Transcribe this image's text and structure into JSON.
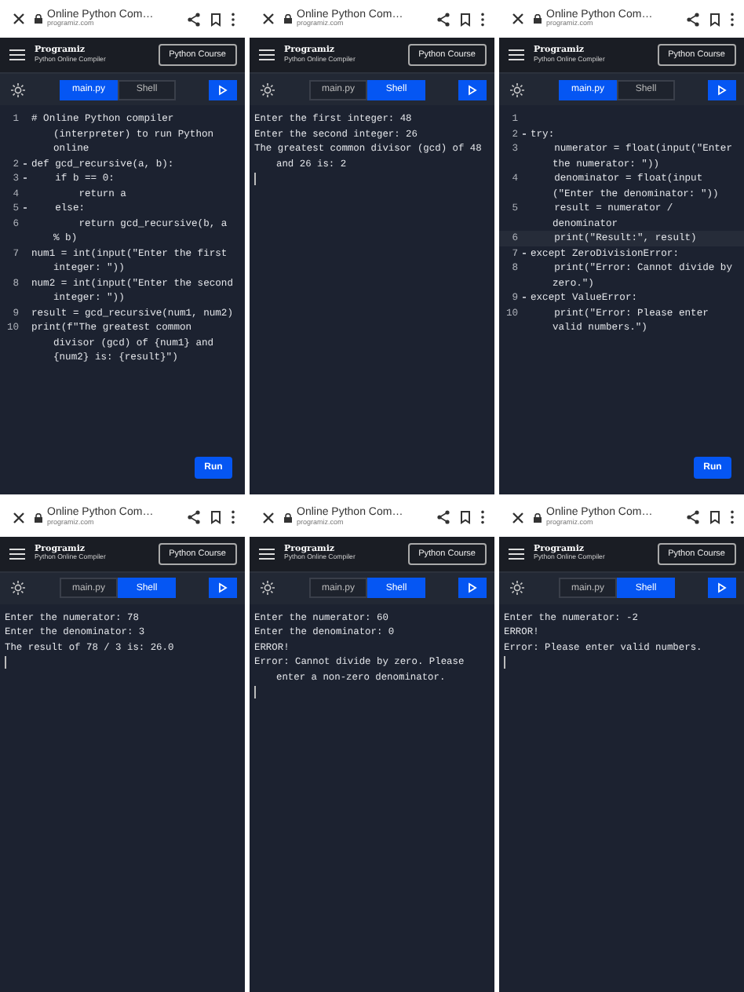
{
  "panels": [
    {
      "browser": {
        "title": "Online Python Com…",
        "url": "programiz.com"
      },
      "header": {
        "logo": "Programiz",
        "subtitle": "Python Online Compiler",
        "course_button": "Python Course"
      },
      "tabs": [
        {
          "label": "main.py",
          "selected": true
        },
        {
          "label": "Shell",
          "selected": false
        }
      ],
      "kind": "editor",
      "lines": [
        {
          "number": "1",
          "fold": false,
          "active": false,
          "text": "# Online Python compiler (interpreter) to run Python online"
        },
        {
          "number": "2",
          "fold": true,
          "active": false,
          "text": "def gcd_recursive(a, b):"
        },
        {
          "number": "3",
          "fold": true,
          "active": false,
          "text": "    if b == 0:"
        },
        {
          "number": "4",
          "fold": false,
          "active": false,
          "text": "        return a"
        },
        {
          "number": "5",
          "fold": true,
          "active": false,
          "text": "    else:"
        },
        {
          "number": "6",
          "fold": false,
          "active": false,
          "text": "        return gcd_recursive(b, a % b)"
        },
        {
          "number": "7",
          "fold": false,
          "active": false,
          "text": "num1 = int(input(\"Enter the first integer: \"))"
        },
        {
          "number": "8",
          "fold": false,
          "active": false,
          "text": "num2 = int(input(\"Enter the second integer: \"))"
        },
        {
          "number": "9",
          "fold": false,
          "active": false,
          "text": "result = gcd_recursive(num1, num2)"
        },
        {
          "number": "10",
          "fold": false,
          "active": false,
          "text": "print(f\"The greatest common divisor (gcd) of {num1} and {num2} is: {result}\")"
        }
      ],
      "run_button": "Run"
    },
    {
      "browser": {
        "title": "Online Python Com…",
        "url": "programiz.com"
      },
      "header": {
        "logo": "Programiz",
        "subtitle": "Python Online Compiler",
        "course_button": "Python Course"
      },
      "tabs": [
        {
          "label": "main.py",
          "selected": false
        },
        {
          "label": "Shell",
          "selected": true
        }
      ],
      "kind": "shell",
      "output": [
        "Enter the first integer: 48",
        "Enter the second integer: 26",
        "The greatest common divisor (gcd) of 48 and 26 is: 2"
      ]
    },
    {
      "browser": {
        "title": "Online Python Com…",
        "url": "programiz.com"
      },
      "header": {
        "logo": "Programiz",
        "subtitle": "Python Online Compiler",
        "course_button": "Python Course"
      },
      "tabs": [
        {
          "label": "main.py",
          "selected": true
        },
        {
          "label": "Shell",
          "selected": false
        }
      ],
      "kind": "editor",
      "lines": [
        {
          "number": "1",
          "fold": false,
          "active": false
        },
        {
          "number": "2",
          "fold": true,
          "active": false,
          "text": "try:"
        },
        {
          "number": "3",
          "fold": false,
          "active": false,
          "text": "    numerator = float(input(\"Enter the numerator: \"))"
        },
        {
          "number": "4",
          "fold": false,
          "active": false,
          "text": "    denominator = float(input (\"Enter the denominator: \"))"
        },
        {
          "number": "5",
          "fold": false,
          "active": false,
          "text": "    result = numerator / denominator"
        },
        {
          "number": "6",
          "fold": false,
          "active": true,
          "text": "    print(\"Result:\", result)"
        },
        {
          "number": "7",
          "fold": true,
          "active": false,
          "text": "except ZeroDivisionError:"
        },
        {
          "number": "8",
          "fold": false,
          "active": false,
          "text": "    print(\"Error: Cannot divide by zero.\")"
        },
        {
          "number": "9",
          "fold": true,
          "active": false,
          "text": "except ValueError:"
        },
        {
          "number": "10",
          "fold": false,
          "active": false,
          "text": "    print(\"Error: Please enter valid numbers.\")"
        }
      ],
      "run_button": "Run"
    },
    {
      "browser": {
        "title": "Online Python Com…",
        "url": "programiz.com"
      },
      "header": {
        "logo": "Programiz",
        "subtitle": "Python Online Compiler",
        "course_button": "Python Course"
      },
      "tabs": [
        {
          "label": "main.py",
          "selected": false
        },
        {
          "label": "Shell",
          "selected": true
        }
      ],
      "kind": "shell",
      "output": [
        "Enter the numerator: 78",
        "Enter the denominator: 3",
        "The result of 78 / 3 is: 26.0"
      ]
    },
    {
      "browser": {
        "title": "Online Python Com…",
        "url": "programiz.com"
      },
      "header": {
        "logo": "Programiz",
        "subtitle": "Python Online Compiler",
        "course_button": "Python Course"
      },
      "tabs": [
        {
          "label": "main.py",
          "selected": false
        },
        {
          "label": "Shell",
          "selected": true
        }
      ],
      "kind": "shell",
      "output": [
        "Enter the numerator: 60",
        "Enter the denominator: 0",
        "ERROR!",
        "Error: Cannot divide by zero. Please enter a non-zero denominator."
      ]
    },
    {
      "browser": {
        "title": "Online Python Com…",
        "url": "programiz.com"
      },
      "header": {
        "logo": "Programiz",
        "subtitle": "Python Online Compiler",
        "course_button": "Python Course"
      },
      "tabs": [
        {
          "label": "main.py",
          "selected": false
        },
        {
          "label": "Shell",
          "selected": true
        }
      ],
      "kind": "shell",
      "output": [
        "Enter the numerator: -2",
        "ERROR!",
        "Error: Please enter valid numbers."
      ]
    }
  ]
}
